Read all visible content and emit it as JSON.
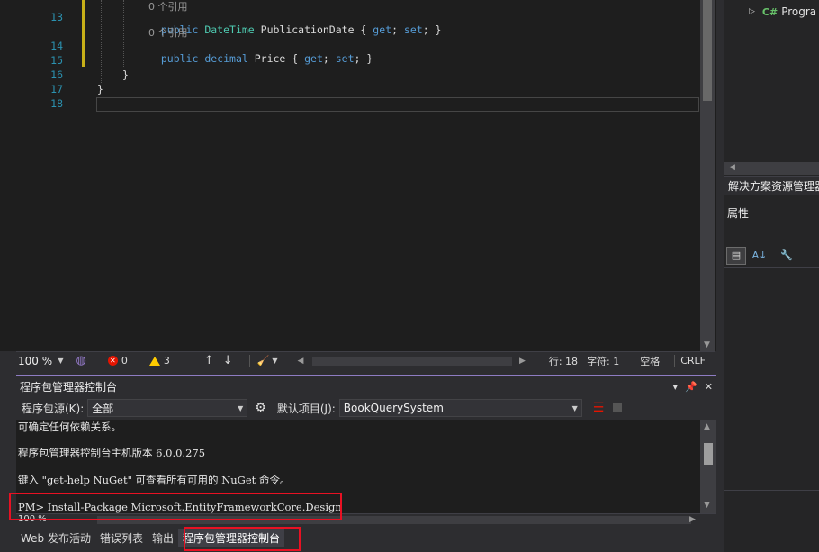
{
  "editor": {
    "lines": [
      {
        "num": "",
        "codelens": "0 个引用"
      },
      {
        "num": "13",
        "code": [
          {
            "t": "public ",
            "c": "kw"
          },
          {
            "t": "DateTime",
            "c": "type"
          },
          {
            "t": " PublicationDate { ",
            "c": ""
          },
          {
            "t": "get",
            "c": "kw"
          },
          {
            "t": "; ",
            "c": ""
          },
          {
            "t": "set",
            "c": "kw"
          },
          {
            "t": "; }",
            "c": ""
          }
        ]
      },
      {
        "num": "",
        "codelens": "0 个引用"
      },
      {
        "num": "14",
        "code": [
          {
            "t": "public ",
            "c": "kw"
          },
          {
            "t": "decimal",
            "c": "kw"
          },
          {
            "t": " Price { ",
            "c": ""
          },
          {
            "t": "get",
            "c": "kw"
          },
          {
            "t": "; ",
            "c": ""
          },
          {
            "t": "set",
            "c": "kw"
          },
          {
            "t": "; }",
            "c": ""
          }
        ]
      },
      {
        "num": "15",
        "code": []
      },
      {
        "num": "16",
        "code": [
          {
            "t": "}",
            "c": ""
          }
        ]
      },
      {
        "num": "17",
        "code": [
          {
            "t": "}",
            "c": ""
          }
        ]
      },
      {
        "num": "18",
        "code": []
      }
    ]
  },
  "status_bar": {
    "zoom": "100 %",
    "errors": "0",
    "warnings": "3",
    "line": "行: 18",
    "char": "字符: 1",
    "spacing": "空格",
    "eol": "CRLF"
  },
  "solution_explorer": {
    "tree_item": "Progra",
    "tab_label": "解决方案资源管理器"
  },
  "properties": {
    "title": "属性"
  },
  "pmc": {
    "title": "程序包管理器控制台",
    "source_label": "程序包源(K):",
    "source_value": "全部",
    "project_label": "默认项目(J):",
    "project_value": "BookQuerySystem",
    "output": [
      "可确定任何依赖关系。",
      "程序包管理器控制台主机版本 6.0.0.275",
      "键入 \"get-help NuGet\" 可查看所有可用的 NuGet 命令。",
      "PM> Install-Package Microsoft.EntityFrameworkCore.Design"
    ],
    "zoom": "100 %"
  },
  "bottom_tabs": [
    "Web 发布活动",
    "错误列表",
    "输出",
    "程序包管理器控制台"
  ],
  "colors": {
    "accent": "#8e7cc3",
    "highlight": "#e81123",
    "keyword": "#569cd6",
    "type": "#4ec9b0",
    "line_number": "#2b91af"
  }
}
